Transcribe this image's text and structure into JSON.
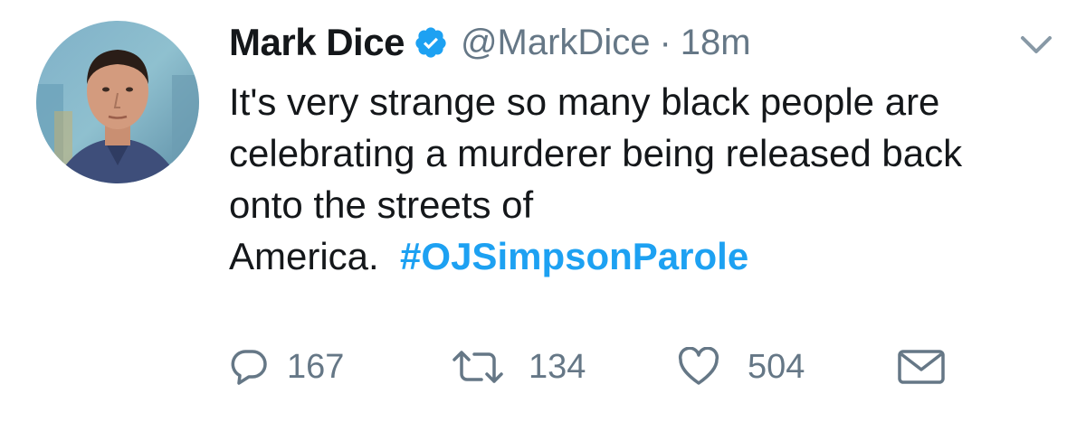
{
  "tweet": {
    "author": {
      "name": "Mark Dice",
      "handle": "@MarkDice",
      "verified": true
    },
    "separator": "·",
    "time": "18m",
    "text_main": "It's very strange so many black people are celebrating a murderer being released back onto the streets of America.",
    "hashtag": "#OJSimpsonParole",
    "actions": {
      "reply_count": "167",
      "retweet_count": "134",
      "like_count": "504"
    }
  },
  "icons": {
    "verified": "verified-badge-icon",
    "caret": "chevron-down-icon",
    "reply": "reply-icon",
    "retweet": "retweet-icon",
    "like": "heart-icon",
    "dm": "envelope-icon"
  },
  "colors": {
    "text": "#14171a",
    "secondary": "#657786",
    "link": "#1da1f2",
    "verified": "#1da1f2"
  }
}
